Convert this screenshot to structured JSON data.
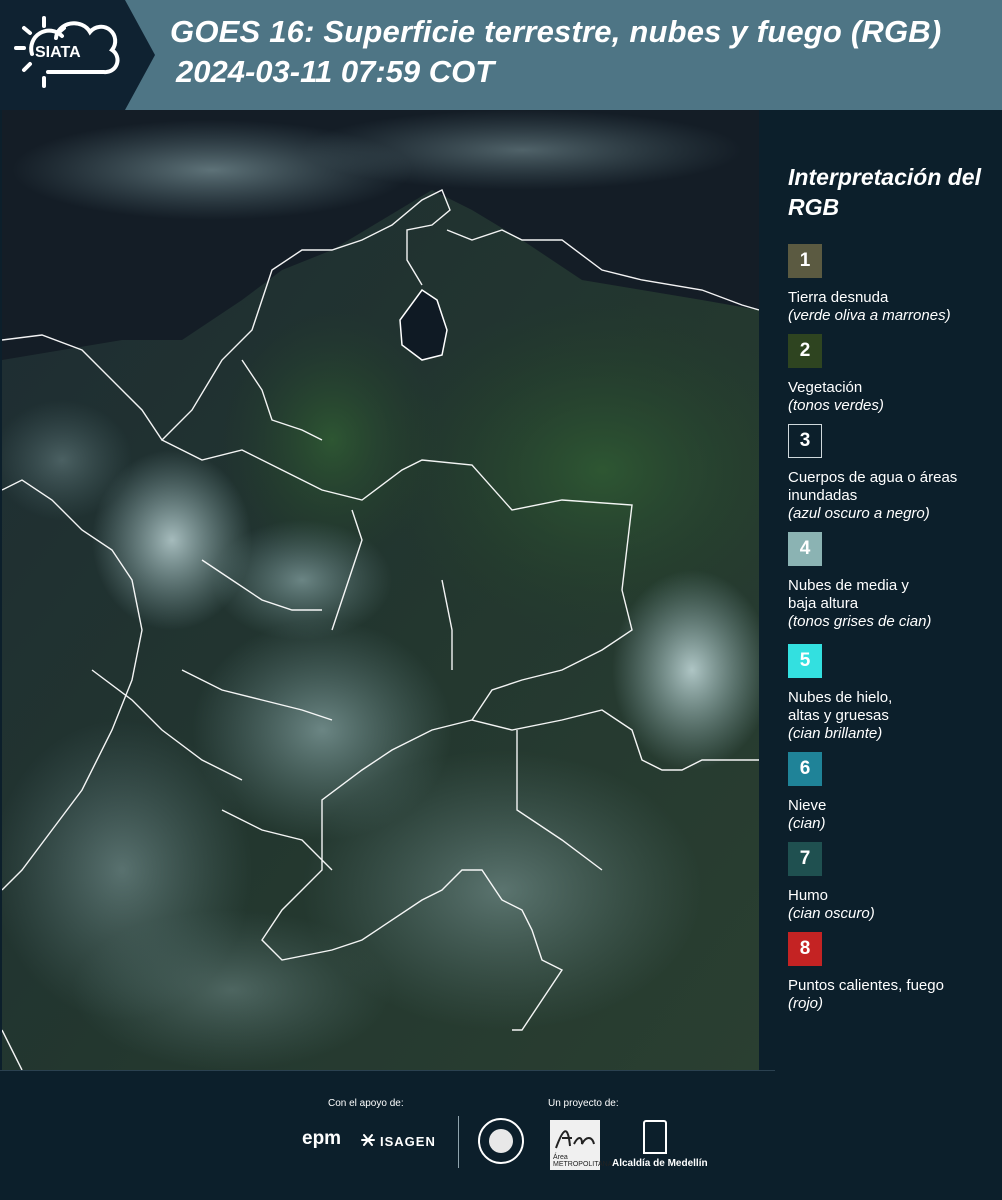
{
  "header": {
    "logo_text": "SIATA",
    "title_line1": "GOES 16: Superficie terrestre, nubes y fuego (RGB)",
    "title_line2": "2024-03-11 07:59 COT"
  },
  "legend": {
    "title": "Interpretación del RGB",
    "items": [
      {
        "number": "1",
        "label": "Tierra desnuda",
        "note": "(verde oliva a marrones)",
        "color": "#5b5a41"
      },
      {
        "number": "2",
        "label": "Vegetación",
        "note": "(tonos verdes)",
        "color": "#2e4420"
      },
      {
        "number": "3",
        "label": "Cuerpos de agua o áreas inundadas",
        "note": "(azul oscuro a negro)",
        "color": "#0c1f2b"
      },
      {
        "number": "4",
        "label": "Nubes de media y baja altura",
        "note": "(tonos grises de cian)",
        "color": "#8bb3b3"
      },
      {
        "number": "5",
        "label": "Nubes de hielo, altas y gruesas",
        "note": "(cian brillante)",
        "color": "#33e0e0"
      },
      {
        "number": "6",
        "label": "Nieve",
        "note": "(cian)",
        "color": "#1f8398"
      },
      {
        "number": "7",
        "label": "Humo",
        "note": "(cian oscuro)",
        "color": "#1f5050"
      },
      {
        "number": "8",
        "label": "Puntos calientes, fuego",
        "note": "(rojo)",
        "color": "#c42323"
      }
    ]
  },
  "footer": {
    "support_label": "Con el apoyo de:",
    "project_label": "Un proyecto de:",
    "sponsors": [
      "epm",
      "ISAGEN"
    ],
    "partners": [
      "Área METROPOLITANA",
      "Alcaldía de Medellín"
    ]
  }
}
